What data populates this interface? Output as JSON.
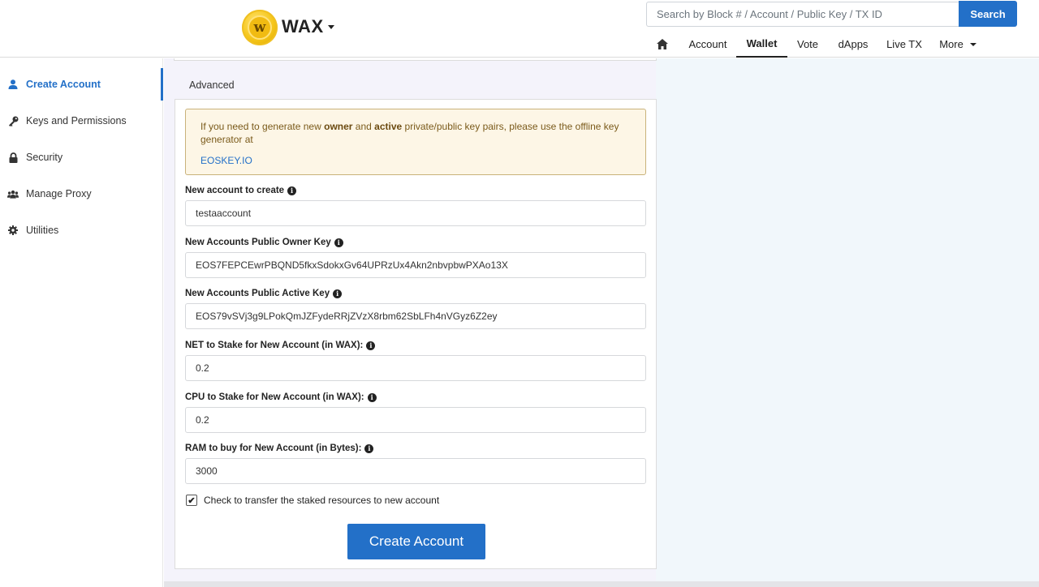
{
  "header": {
    "brand": "WAX",
    "search_placeholder": "Search by Block # / Account / Public Key / TX ID",
    "search_button": "Search",
    "nav": [
      "Account",
      "Wallet",
      "Vote",
      "dApps",
      "Live TX",
      "More"
    ],
    "active_nav": "Wallet"
  },
  "sidebar": {
    "items": [
      {
        "label": "Create Account",
        "icon": "user-icon",
        "active": true
      },
      {
        "label": "Keys and Permissions",
        "icon": "key-icon"
      },
      {
        "label": "Security",
        "icon": "lock-icon"
      },
      {
        "label": "Manage Proxy",
        "icon": "users-icon"
      },
      {
        "label": "Utilities",
        "icon": "gear-icon"
      }
    ]
  },
  "main": {
    "tab": "Advanced",
    "alert": {
      "text_1": "If you need to generate new ",
      "owner": "owner",
      "text_2": " and ",
      "active": "active",
      "text_3": " private/public key pairs, please use the offline key generator at",
      "link": "EOSKEY.IO"
    },
    "form": {
      "account_label": "New account to create",
      "account_value": "testaaccount",
      "owner_key_label": "New Accounts Public Owner Key",
      "owner_key_value": "EOS7FEPCEwrPBQND5fkxSdokxGv64UPRzUx4Akn2nbvpbwPXAo13X",
      "active_key_label": "New Accounts Public Active Key",
      "active_key_value": "EOS79vSVj3g9LPokQmJZFydeRRjZVzX8rbm62SbLFh4nVGyz6Z2ey",
      "net_label": "NET to Stake for New Account (in WAX):",
      "net_value": "0.2",
      "cpu_label": "CPU to Stake for New Account (in WAX):",
      "cpu_value": "0.2",
      "ram_label": "RAM to buy for New Account (in Bytes):",
      "ram_value": "3000",
      "transfer_label": "Check to transfer the staked resources to new account",
      "transfer_checked": true,
      "submit": "Create Account"
    }
  },
  "colors": {
    "accent": "#2370c8",
    "alert_bg": "#fdf6e6",
    "panel_bg": "#f4f3fb"
  }
}
